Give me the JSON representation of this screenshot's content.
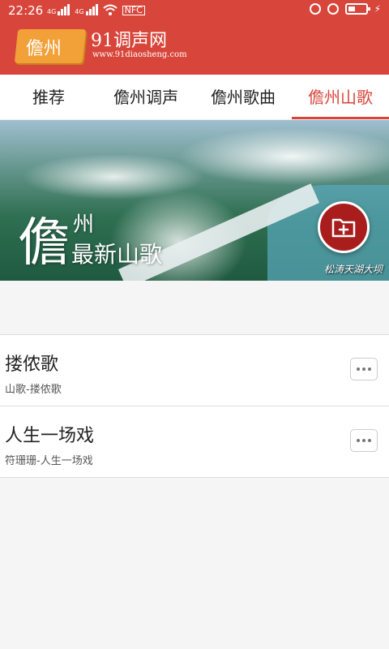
{
  "status": {
    "time": "22:26",
    "net1": "4G",
    "net2": "4G",
    "nfc": "NFC"
  },
  "header": {
    "logo_badge": "儋州",
    "logo_text": "91调声网",
    "logo_url": "www.91diaosheng.com"
  },
  "tabs": [
    {
      "label": "推荐",
      "active": false
    },
    {
      "label": "儋州调声",
      "active": false
    },
    {
      "label": "儋州歌曲",
      "active": false
    },
    {
      "label": "儋州山歌",
      "active": true
    }
  ],
  "banner": {
    "big_char": "儋",
    "sub1": "州",
    "sub2": "最新山歌",
    "caption": "松涛天湖大坝"
  },
  "songs": [
    {
      "title": "搂侬歌",
      "subtitle": "山歌-搂侬歌"
    },
    {
      "title": "人生一场戏",
      "subtitle": "符珊珊-人生一场戏"
    }
  ],
  "colors": {
    "brand": "#d8463b",
    "fab": "#a91d1d",
    "badge": "#f2a038"
  }
}
